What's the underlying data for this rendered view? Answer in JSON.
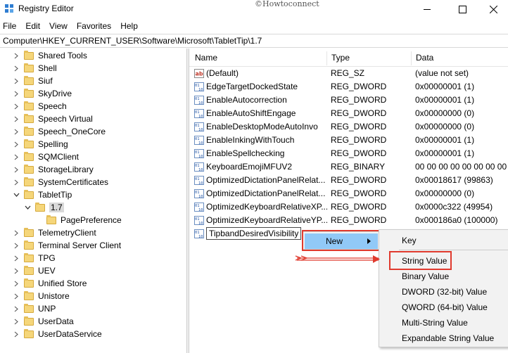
{
  "window": {
    "title": "Registry Editor",
    "watermark": "©Howtoconnect"
  },
  "menu": [
    "File",
    "Edit",
    "View",
    "Favorites",
    "Help"
  ],
  "address": "Computer\\HKEY_CURRENT_USER\\Software\\Microsoft\\TabletTip\\1.7",
  "tree": [
    {
      "label": "Shared Tools",
      "level": 0,
      "expand": "collapsed"
    },
    {
      "label": "Shell",
      "level": 0,
      "expand": "collapsed"
    },
    {
      "label": "Siuf",
      "level": 0,
      "expand": "collapsed"
    },
    {
      "label": "SkyDrive",
      "level": 0,
      "expand": "collapsed"
    },
    {
      "label": "Speech",
      "level": 0,
      "expand": "collapsed"
    },
    {
      "label": "Speech Virtual",
      "level": 0,
      "expand": "collapsed"
    },
    {
      "label": "Speech_OneCore",
      "level": 0,
      "expand": "collapsed"
    },
    {
      "label": "Spelling",
      "level": 0,
      "expand": "collapsed"
    },
    {
      "label": "SQMClient",
      "level": 0,
      "expand": "collapsed"
    },
    {
      "label": "StorageLibrary",
      "level": 0,
      "expand": "collapsed"
    },
    {
      "label": "SystemCertificates",
      "level": 0,
      "expand": "collapsed"
    },
    {
      "label": "TabletTip",
      "level": 0,
      "expand": "expanded"
    },
    {
      "label": "1.7",
      "level": 1,
      "expand": "expanded",
      "selected": true
    },
    {
      "label": "PagePreference",
      "level": 2,
      "expand": "none"
    },
    {
      "label": "TelemetryClient",
      "level": 0,
      "expand": "collapsed"
    },
    {
      "label": "Terminal Server Client",
      "level": 0,
      "expand": "collapsed"
    },
    {
      "label": "TPG",
      "level": 0,
      "expand": "collapsed"
    },
    {
      "label": "UEV",
      "level": 0,
      "expand": "collapsed"
    },
    {
      "label": "Unified Store",
      "level": 0,
      "expand": "collapsed"
    },
    {
      "label": "Unistore",
      "level": 0,
      "expand": "collapsed"
    },
    {
      "label": "UNP",
      "level": 0,
      "expand": "collapsed"
    },
    {
      "label": "UserData",
      "level": 0,
      "expand": "collapsed"
    },
    {
      "label": "UserDataService",
      "level": 0,
      "expand": "collapsed"
    }
  ],
  "columns": {
    "name": "Name",
    "type": "Type",
    "data": "Data"
  },
  "values": [
    {
      "name": "(Default)",
      "type": "REG_SZ",
      "data": "(value not set)",
      "icon": "string-value-icon"
    },
    {
      "name": "EdgeTargetDockedState",
      "type": "REG_DWORD",
      "data": "0x00000001 (1)",
      "icon": "binary-value-icon"
    },
    {
      "name": "EnableAutocorrection",
      "type": "REG_DWORD",
      "data": "0x00000001 (1)",
      "icon": "binary-value-icon"
    },
    {
      "name": "EnableAutoShiftEngage",
      "type": "REG_DWORD",
      "data": "0x00000000 (0)",
      "icon": "binary-value-icon"
    },
    {
      "name": "EnableDesktopModeAutoInvo",
      "type": "REG_DWORD",
      "data": "0x00000000 (0)",
      "icon": "binary-value-icon"
    },
    {
      "name": "EnableInkingWithTouch",
      "type": "REG_DWORD",
      "data": "0x00000001 (1)",
      "icon": "binary-value-icon"
    },
    {
      "name": "EnableSpellchecking",
      "type": "REG_DWORD",
      "data": "0x00000001 (1)",
      "icon": "binary-value-icon"
    },
    {
      "name": "KeyboardEmojiMFUV2",
      "type": "REG_BINARY",
      "data": "00 00 00 00 00 00 00 00 00",
      "icon": "binary-value-icon"
    },
    {
      "name": "OptimizedDictationPanelRelat...",
      "type": "REG_DWORD",
      "data": "0x00018617 (99863)",
      "icon": "binary-value-icon"
    },
    {
      "name": "OptimizedDictationPanelRelat...",
      "type": "REG_DWORD",
      "data": "0x00000000 (0)",
      "icon": "binary-value-icon"
    },
    {
      "name": "OptimizedKeyboardRelativeXP...",
      "type": "REG_DWORD",
      "data": "0x0000c322 (49954)",
      "icon": "binary-value-icon"
    },
    {
      "name": "OptimizedKeyboardRelativeYP...",
      "type": "REG_DWORD",
      "data": "0x000186a0 (100000)",
      "icon": "binary-value-icon"
    },
    {
      "name": "TipbandDesiredVisibility",
      "type": "",
      "data": "",
      "icon": "binary-value-icon",
      "editing": true
    }
  ],
  "context": {
    "new_label": "New",
    "submenu": [
      "Key",
      "String Value",
      "Binary Value",
      "DWORD (32-bit) Value",
      "QWORD (64-bit) Value",
      "Multi-String Value",
      "Expandable String Value"
    ]
  },
  "colors": {
    "highlight": "#91c9f7",
    "annotation_red": "#e03a2e",
    "menu_bg": "#f2f2f2"
  }
}
